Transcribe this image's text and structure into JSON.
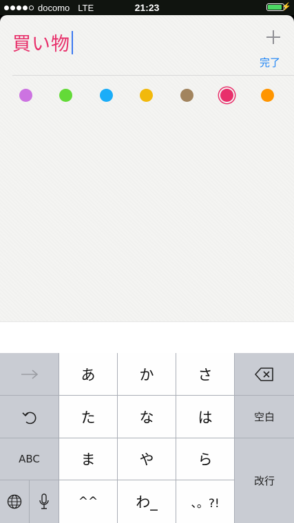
{
  "status_bar": {
    "carrier": "docomo",
    "network": "LTE",
    "time": "21:23",
    "signal_bars": 4,
    "battery_level": 0.85
  },
  "note": {
    "title": "買い物",
    "add_icon": "plus-icon",
    "done_label": "完了",
    "colors": [
      {
        "name": "purple",
        "hex": "#cc73e1"
      },
      {
        "name": "green",
        "hex": "#63da38"
      },
      {
        "name": "blue",
        "hex": "#1badf8"
      },
      {
        "name": "yellow",
        "hex": "#f2b90c"
      },
      {
        "name": "brown",
        "hex": "#a2845e"
      },
      {
        "name": "red",
        "hex": "#e8306b",
        "selected": true
      },
      {
        "name": "orange",
        "hex": "#ff9500"
      }
    ]
  },
  "keyboard": {
    "kana_keys": [
      "あ",
      "か",
      "さ",
      "た",
      "な",
      "は",
      "ま",
      "や",
      "ら",
      "^^",
      "わ_",
      "、。?!"
    ],
    "space_label": "空白",
    "return_label": "改行",
    "abc_label": "ABC",
    "icons": [
      "arrow-right-icon",
      "undo-icon",
      "globe-icon",
      "microphone-icon",
      "delete-icon"
    ]
  }
}
